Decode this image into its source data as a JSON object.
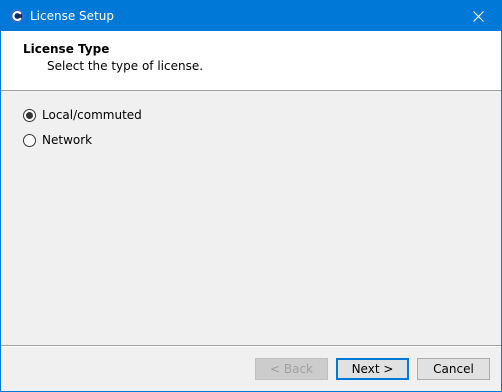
{
  "window": {
    "title": "License Setup"
  },
  "header": {
    "title": "License Type",
    "subtitle": "Select the type of license."
  },
  "license_options": [
    {
      "label": "Local/commuted",
      "selected": true
    },
    {
      "label": "Network",
      "selected": false
    }
  ],
  "buttons": {
    "back": {
      "label": "< Back",
      "enabled": false
    },
    "next": {
      "label": "Next >",
      "enabled": true,
      "default": true
    },
    "cancel": {
      "label": "Cancel",
      "enabled": true
    }
  },
  "icons": {
    "app": "app-logo-icon",
    "close": "close-icon"
  },
  "colors": {
    "titlebar": "#0078d7",
    "accent": "#0078d7",
    "dialog_background": "#f0f0f0"
  }
}
